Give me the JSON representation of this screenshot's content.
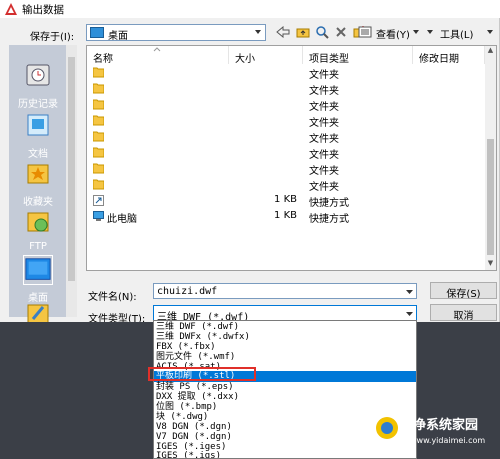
{
  "window": {
    "title": "输出数据"
  },
  "toolbar": {
    "save_in_label": "保存于(I):",
    "location": "桌面",
    "view_label": "查看(Y)",
    "tools_label": "工具(L)"
  },
  "places": [
    {
      "name": "历史记录",
      "icon": "history-icon"
    },
    {
      "name": "文档",
      "icon": "documents-icon"
    },
    {
      "name": "收藏夹",
      "icon": "favorites-icon"
    },
    {
      "name": "FTP",
      "icon": "ftp-icon"
    },
    {
      "name": "桌面",
      "icon": "desktop-icon",
      "selected": true
    }
  ],
  "list": {
    "columns": [
      "名称",
      "大小",
      "项目类型",
      "修改日期"
    ],
    "rows": [
      {
        "name": "",
        "size": "",
        "type": "文件夹",
        "icon": "folder-icon"
      },
      {
        "name": "",
        "size": "",
        "type": "文件夹",
        "icon": "folder-icon"
      },
      {
        "name": "",
        "size": "",
        "type": "文件夹",
        "icon": "folder-icon"
      },
      {
        "name": "",
        "size": "",
        "type": "文件夹",
        "icon": "folder-icon"
      },
      {
        "name": "",
        "size": "",
        "type": "文件夹",
        "icon": "folder-icon"
      },
      {
        "name": "",
        "size": "",
        "type": "文件夹",
        "icon": "folder-icon"
      },
      {
        "name": "",
        "size": "",
        "type": "文件夹",
        "icon": "folder-icon"
      },
      {
        "name": "",
        "size": "",
        "type": "文件夹",
        "icon": "folder-icon"
      },
      {
        "name": "",
        "size": "1 KB",
        "type": "快捷方式",
        "icon": "shortcut-icon"
      },
      {
        "name": "此电脑",
        "size": "1 KB",
        "type": "快捷方式",
        "icon": "computer-icon"
      }
    ]
  },
  "filename": {
    "label": "文件名(N):",
    "value": "chuizi.dwf"
  },
  "filetype": {
    "label": "文件类型(T):",
    "value": "三维 DWF (*.dwf)"
  },
  "buttons": {
    "save": "保存(S)",
    "cancel": "取消"
  },
  "dropdown_options": [
    "三维 DWF (*.dwf)",
    "三维 DWFx (*.dwfx)",
    "FBX (*.fbx)",
    "图元文件 (*.wmf)",
    "ACIS (*.sat)",
    "平板印刷 (*.stl)",
    "封装 PS (*.eps)",
    "DXX 提取 (*.dxx)",
    "位图 (*.bmp)",
    "块 (*.dwg)",
    "V8 DGN (*.dgn)",
    "V7 DGN (*.dgn)",
    "IGES (*.iges)",
    "IGES (*.igs)"
  ],
  "highlighted_option_index": 5,
  "watermark": {
    "text": "纯净系统家园",
    "url": "www.yidaimei.com"
  },
  "colors": {
    "selection": "#0078d7",
    "highlight_box": "#e0302a",
    "folder": "#f5c542"
  }
}
